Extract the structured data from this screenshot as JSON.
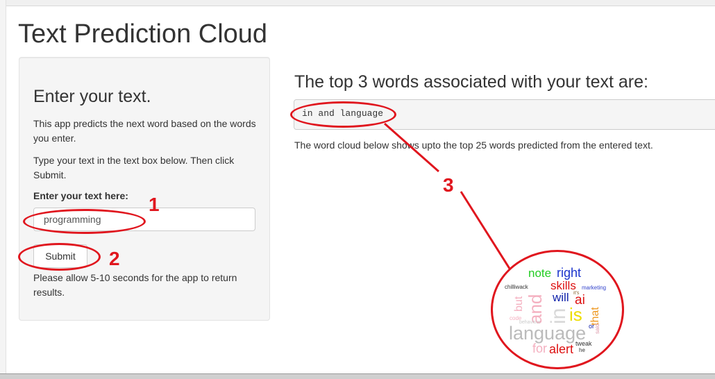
{
  "app": {
    "title": "Text Prediction Cloud"
  },
  "sidebar": {
    "heading": "Enter your text.",
    "intro": "This app predicts the next word based on the words you enter.",
    "instructions": "Type your text in the text box below. Then click Submit.",
    "input_label": "Enter your text here:",
    "input_value": "programming",
    "submit_label": "Submit",
    "note": "Please allow 5-10 seconds for the app to return results."
  },
  "main": {
    "heading": "The top 3 words associated with your text are:",
    "result_text": "in and language",
    "caption": "The word cloud below shows upto the top 25 words predicted from the entered text."
  },
  "annotations": {
    "label_1": "1",
    "label_2": "2",
    "label_3": "3",
    "color": "#e0161e"
  },
  "word_cloud": {
    "words": [
      {
        "text": "note",
        "color": "#22cc22"
      },
      {
        "text": "right",
        "color": "#1a33cc"
      },
      {
        "text": "chilliwack",
        "color": "#333333"
      },
      {
        "text": "skills",
        "color": "#dd1111"
      },
      {
        "text": "marketing",
        "color": "#3344cc"
      },
      {
        "text": "will",
        "color": "#1122aa"
      },
      {
        "text": "it's",
        "color": "#886633"
      },
      {
        "text": "ai",
        "color": "#dd1111"
      },
      {
        "text": "but",
        "color": "#f4b0c0"
      },
      {
        "text": "and",
        "color": "#f4b0c0"
      },
      {
        "text": "in",
        "color": "#d8d8d8"
      },
      {
        "text": "is",
        "color": "#eedd00"
      },
      {
        "text": "that",
        "color": "#ee9922"
      },
      {
        "text": "code",
        "color": "#f4b0c0"
      },
      {
        "text": "behaviour",
        "color": "#cccccc"
      },
      {
        "text": "said",
        "color": "#dd99aa"
      },
      {
        "text": "or",
        "color": "#1122aa"
      },
      {
        "text": "language",
        "color": "#bbbbbb"
      },
      {
        "text": "for",
        "color": "#f4b0c0"
      },
      {
        "text": "alert",
        "color": "#dd1111"
      },
      {
        "text": "tweak",
        "color": "#333333"
      },
      {
        "text": "he",
        "color": "#333333"
      }
    ]
  }
}
